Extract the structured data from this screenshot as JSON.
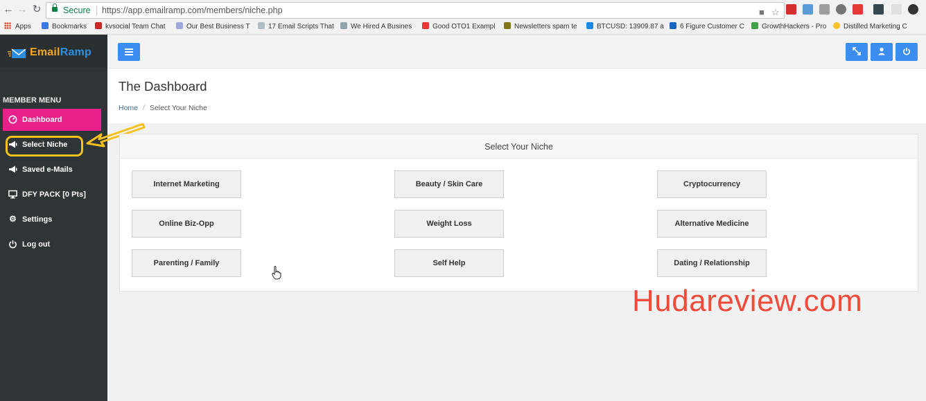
{
  "browser": {
    "secure_label": "Secure",
    "url": "https://app.emailramp.com/members/niche.php",
    "bookmarks": [
      {
        "label": "Apps",
        "color": "#e04a2a"
      },
      {
        "label": "Bookmarks",
        "color": "#3b78e7"
      },
      {
        "label": "kvsocial Team Chat",
        "color": "#c62828"
      },
      {
        "label": "Our Best Business T",
        "color": "#9fa8da"
      },
      {
        "label": "17 Email Scripts That",
        "color": "#b0bec5"
      },
      {
        "label": "We Hired A Busines",
        "color": "#90a4ae"
      },
      {
        "label": "Good OTO1 Exampl",
        "color": "#e53935"
      },
      {
        "label": "Newsletters spam te",
        "color": "#827717"
      },
      {
        "label": "BTCUSD: 13909.87 a",
        "color": "#1e88e5"
      },
      {
        "label": "6 Figure Customer C",
        "color": "#1565c0"
      },
      {
        "label": "GrowthHackers - Pro",
        "color": "#43a047"
      },
      {
        "label": "Distilled Marketing C",
        "color": "#fbc02d"
      }
    ]
  },
  "app": {
    "logo": {
      "part1": "Email",
      "part2": "Ramp"
    },
    "menu_header": "MEMBER MENU",
    "menu": [
      {
        "label": "Dashboard",
        "icon": "dashboard-icon",
        "active": true
      },
      {
        "label": "Select Niche",
        "icon": "megaphone-icon",
        "active": false
      },
      {
        "label": "Saved e-Mails",
        "icon": "megaphone-icon",
        "active": false
      },
      {
        "label": "DFY PACK [0 Pts]",
        "icon": "monitor-icon",
        "active": false
      },
      {
        "label": "Settings",
        "icon": "gear-icon",
        "active": false
      },
      {
        "label": "Log out",
        "icon": "power-icon",
        "active": false
      }
    ],
    "page_title": "The Dashboard",
    "breadcrumb": {
      "home": "Home",
      "current": "Select Your Niche"
    },
    "panel_title": "Select Your Niche",
    "niches": [
      [
        "Internet Marketing",
        "Beauty / Skin Care",
        "Cryptocurrency"
      ],
      [
        "Online Biz-Opp",
        "Weight Loss",
        "Alternative Medicine"
      ],
      [
        "Parenting / Family",
        "Self Help",
        "Dating / Relationship"
      ]
    ],
    "accent_color": "#3b8ef0",
    "active_color": "#e8208a"
  },
  "watermark": "Hudareview.com"
}
